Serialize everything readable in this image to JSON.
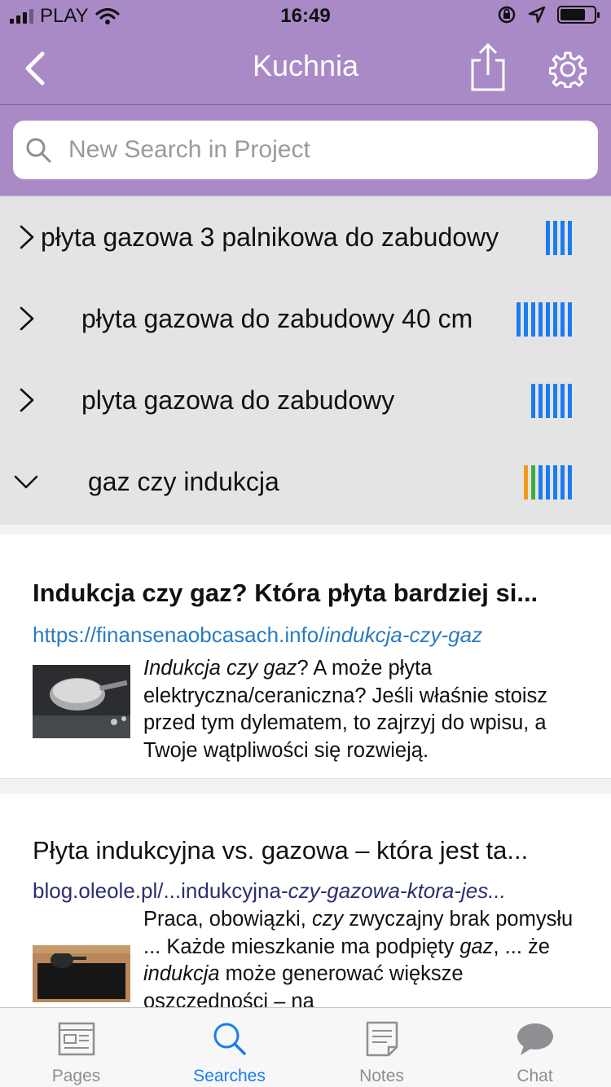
{
  "status_bar": {
    "carrier": "PLAY",
    "time": "16:49"
  },
  "nav": {
    "title": "Kuchnia"
  },
  "search": {
    "placeholder": "New Search in Project"
  },
  "queries": [
    {
      "text": "płyta gazowa 3 palnikowa do zabudowy",
      "expanded": false,
      "bars": [
        "#1a7cf0",
        "#1a7cf0",
        "#1a7cf0",
        "#1a7cf0"
      ]
    },
    {
      "text": "płyta gazowa do zabudowy 40 cm",
      "expanded": false,
      "bars": [
        "#1a7cf0",
        "#1a7cf0",
        "#1a7cf0",
        "#1a7cf0",
        "#1a7cf0",
        "#1a7cf0",
        "#1a7cf0",
        "#1a7cf0"
      ]
    },
    {
      "text": "plyta gazowa do zabudowy",
      "expanded": false,
      "bars": [
        "#1a7cf0",
        "#1a7cf0",
        "#1a7cf0",
        "#1a7cf0",
        "#1a7cf0",
        "#1a7cf0"
      ]
    },
    {
      "text": "gaz czy indukcja",
      "expanded": true,
      "bars": [
        "#f29a1e",
        "#3fae3f",
        "#1a7cf0",
        "#1a7cf0",
        "#1a7cf0",
        "#1a7cf0",
        "#1a7cf0"
      ]
    }
  ],
  "results": [
    {
      "title": "Indukcja czy gaz? Która płyta bardziej si...",
      "url": "https://finansenaobcasach.info/indukcja-czy-gaz",
      "url_plain": "https://finansenaobcasach.info/",
      "url_em": "indukcja-czy-gaz",
      "snippet": [
        {
          "text": "Indukcja czy gaz",
          "em": true
        },
        {
          "text": "? A może płyta elektryczna/ceraniczna? Jeśli właśnie stoisz przed tym dylematem, to zajrzyj do wpisu, a Twoje wątpliwości się rozwieją.",
          "em": false
        }
      ]
    },
    {
      "title": "Płyta indukcyjna vs. gazowa – która jest ta...",
      "url": "blog.oleole.pl/...indukcyjna-czy-gazowa-ktora-jes...",
      "url_plain": "blog.oleole.pl/...indukcyjna-",
      "url_em": "czy-gazowa-ktora-jes...",
      "snippet": [
        {
          "text": "Praca, obowiązki, ",
          "em": false
        },
        {
          "text": "czy",
          "em": true
        },
        {
          "text": " zwyczajny brak pomysłu ... Każde mieszkanie ma podpięty ",
          "em": false
        },
        {
          "text": "gaz",
          "em": true
        },
        {
          "text": ", ... że ",
          "em": false
        },
        {
          "text": "indukcja",
          "em": true
        },
        {
          "text": " może generować większe oszczędności – na",
          "em": false
        }
      ]
    }
  ],
  "scroll_progress": 0.47,
  "tabs": [
    {
      "label": "Pages",
      "icon": "pages-icon",
      "active": false
    },
    {
      "label": "Searches",
      "icon": "search-icon",
      "active": true
    },
    {
      "label": "Notes",
      "icon": "notes-icon",
      "active": false
    },
    {
      "label": "Chat",
      "icon": "chat-icon",
      "active": false
    }
  ],
  "colors": {
    "header": "#a98ac7",
    "accent": "#1a7cf0",
    "query_bg": "#e4e4e4",
    "progress": "#e06767"
  }
}
